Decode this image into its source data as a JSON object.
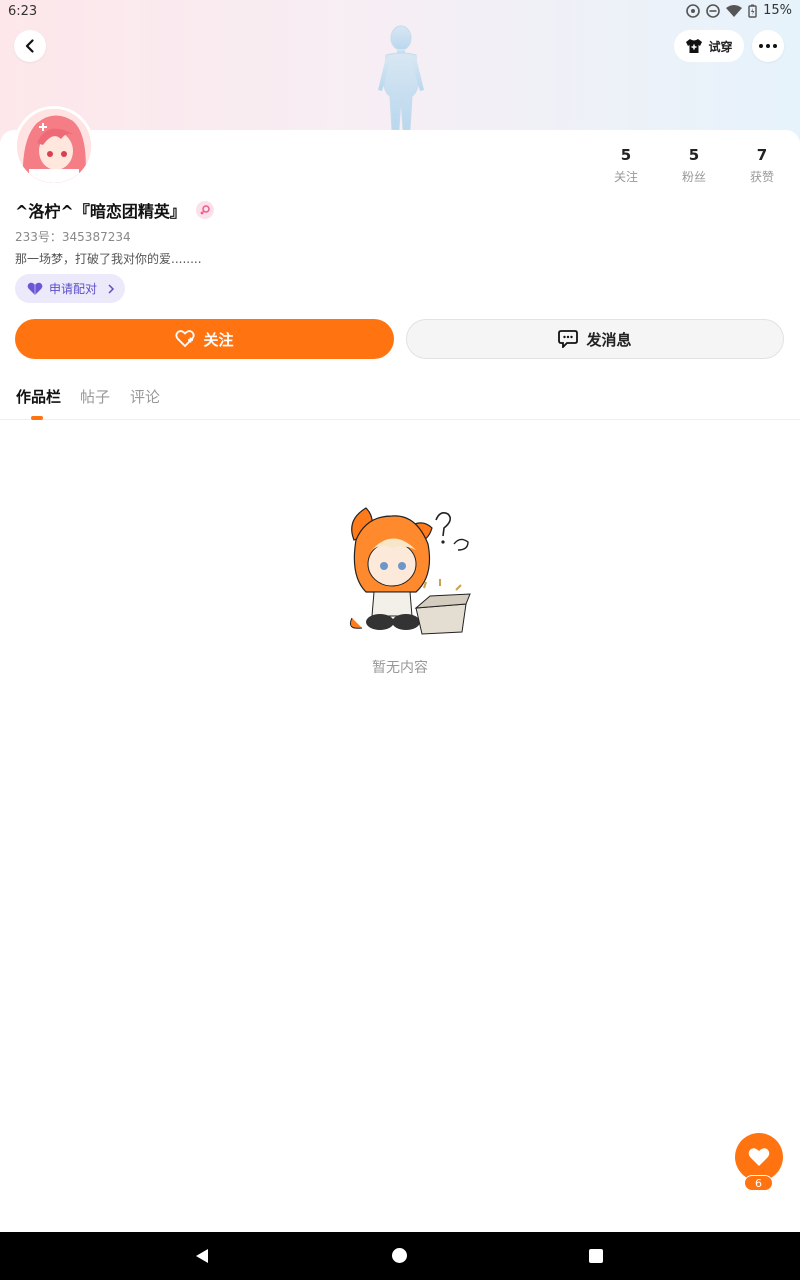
{
  "status_bar": {
    "time": "6:23",
    "battery": "15%"
  },
  "header": {
    "tryon_label": "试穿"
  },
  "profile": {
    "username": "^洛柠^『暗恋团精英』",
    "uid": "233号：345387234",
    "bio": "那一场梦，打破了我对你的爱........",
    "match_label": "申请配对",
    "stats": [
      {
        "value": "5",
        "label": "关注"
      },
      {
        "value": "5",
        "label": "粉丝"
      },
      {
        "value": "7",
        "label": "获赞"
      }
    ]
  },
  "actions": {
    "follow_label": "关注",
    "message_label": "发消息"
  },
  "tabs": [
    {
      "label": "作品栏"
    },
    {
      "label": "帖子"
    },
    {
      "label": "评论"
    }
  ],
  "empty_state": {
    "text": "暂无内容"
  },
  "fab": {
    "like_count": "6"
  },
  "colors": {
    "accent": "#ff7311",
    "match_bg": "#ece9fb",
    "match_text": "#5b4fc8"
  }
}
